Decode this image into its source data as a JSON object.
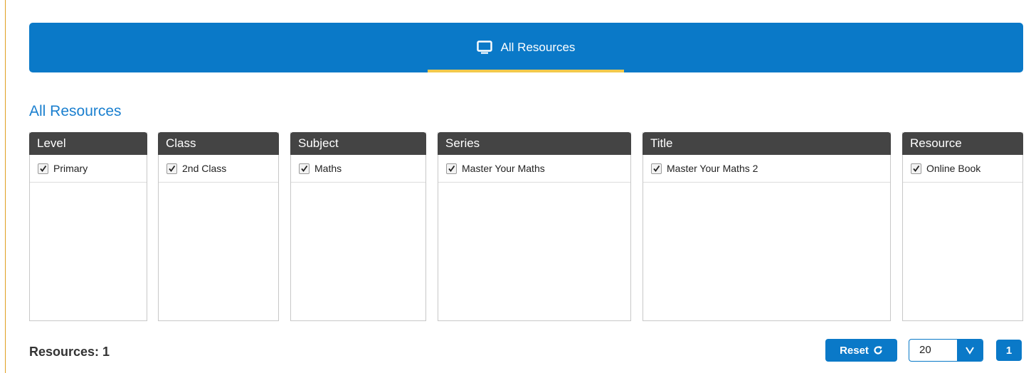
{
  "header": {
    "tab_label": "All Resources",
    "tab_icon": "monitor-icon",
    "accent_color": "#0a79c8",
    "underline_color": "#f2c94c"
  },
  "section_title": "All Resources",
  "filters": {
    "level": {
      "header": "Level",
      "item": "Primary"
    },
    "class": {
      "header": "Class",
      "item": "2nd Class"
    },
    "subject": {
      "header": "Subject",
      "item": "Maths"
    },
    "series": {
      "header": "Series",
      "item": "Master Your Maths"
    },
    "title": {
      "header": "Title",
      "item": "Master Your Maths 2"
    },
    "resource": {
      "header": "Resource",
      "item": "Online Book"
    }
  },
  "footer": {
    "resources_count": "Resources: 1",
    "reset_label": "Reset",
    "per_page_value": "20",
    "page_number": "1"
  }
}
